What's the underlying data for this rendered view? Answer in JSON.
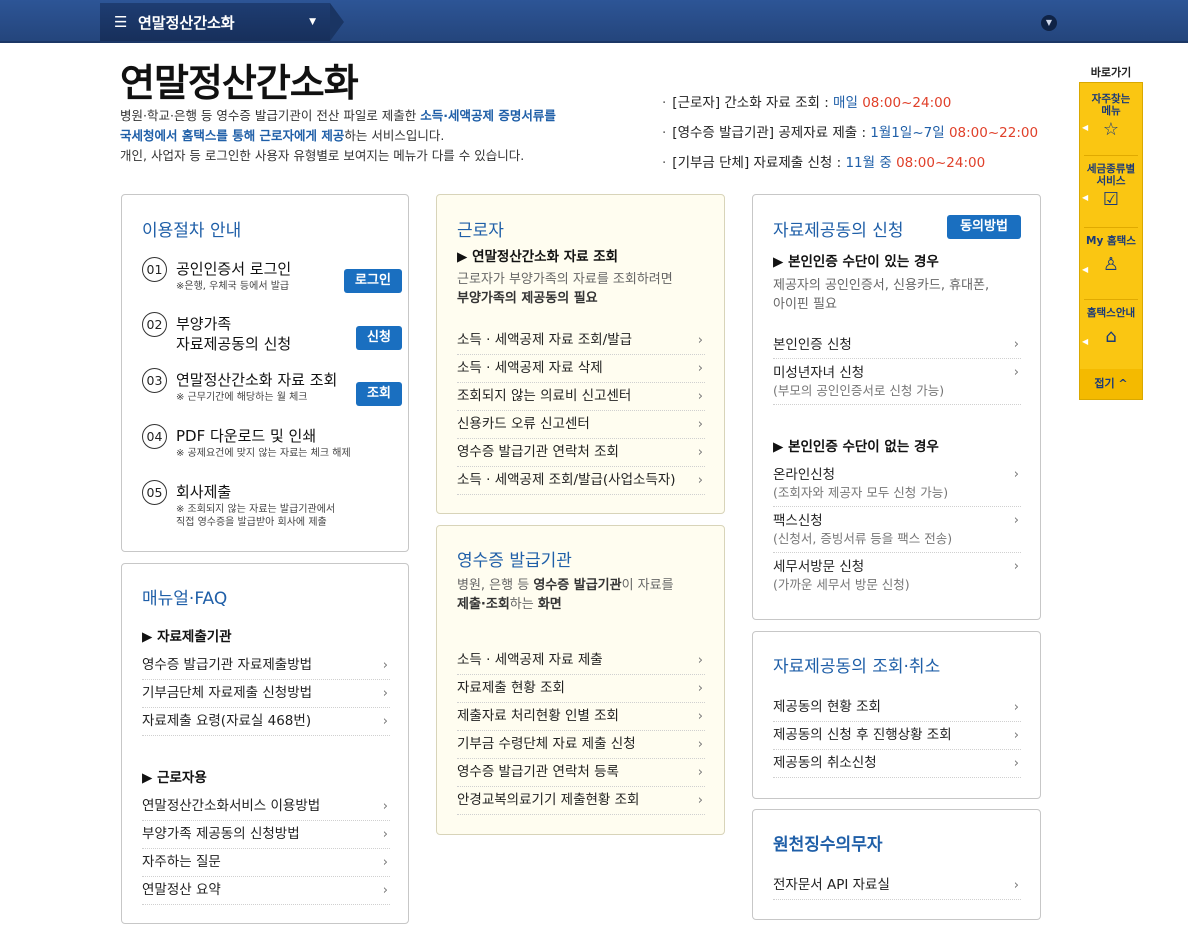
{
  "nav": {
    "title": "연말정산간소화",
    "menu_icon": "hamburger-icon",
    "caret": "▼",
    "expand_icon": "chevron-down-icon"
  },
  "header": {
    "title": "연말정산간소화",
    "intro_1a": "병원·학교·은행 등 영수증 발급기관이 전산 파일로 제출한 ",
    "intro_1b": "소득·세액공제 증명서류를",
    "intro_2a": "국세청에서 홈택스를 통해 근로자에게 제공",
    "intro_2b": "하는 서비스입니다.",
    "intro_3": "개인, 사업자 등 로그인한 사용자 유형별로 보여지는 메뉴가 다를 수 있습니다."
  },
  "schedule": [
    {
      "label": "[근로자] 간소화 자료 조회 : ",
      "period": "매일",
      "time": "08:00~24:00"
    },
    {
      "label": "[영수증 발급기관] 공제자료 제출 : ",
      "period": "1월1일~7일",
      "time": "08:00~22:00"
    },
    {
      "label": "[기부금 단체] 자료제출 신청 : ",
      "period": "11월 중",
      "time": "08:00~24:00"
    }
  ],
  "procedure": {
    "title": "이용절차 안내",
    "steps": [
      {
        "num": "01",
        "label": "공인인증서 로그인",
        "note": "※은행, 우체국 등에서 발급",
        "button": "로그인"
      },
      {
        "num": "02",
        "label": "부양가족",
        "label2": "자료제공동의 신청",
        "button": "신청"
      },
      {
        "num": "03",
        "label": "연말정산간소화 자료 조회",
        "note": "※ 근무기간에 해당하는 월 체크",
        "button": "조회"
      },
      {
        "num": "04",
        "label": "PDF 다운로드 및 인쇄",
        "note": "※ 공제요건에 맞지 않는 자료는 체크 해제"
      },
      {
        "num": "05",
        "label": "회사제출",
        "note": "※ 조회되지 않는 자료는 발급기관에서",
        "note2": "직접 영수증을 발급받아 회사에 제출"
      }
    ]
  },
  "manual": {
    "title": "매뉴얼·FAQ",
    "group1": "▶ 자료제출기관",
    "items1": [
      "영수증 발급기관 자료제출방법",
      "기부금단체 자료제출 신청방법",
      "자료제출 요령(자료실 468번)"
    ],
    "group2": "▶ 근로자용",
    "items2": [
      "연말정산간소화서비스 이용방법",
      "부양가족 제공동의 신청방법",
      "자주하는 질문",
      "연말정산 요약"
    ]
  },
  "worker": {
    "title": "근로자",
    "sub": "▶ 연말정산간소화 자료 조회",
    "desc1": "근로자가 부양가족의 자료를 조회하려면",
    "desc2": "부양가족의 제공동의 필요",
    "items": [
      "소득 · 세액공제 자료 조회/발급",
      "소득 · 세액공제 자료 삭제",
      "조회되지 않는 의료비 신고센터",
      "신용카드 오류 신고센터",
      "영수증 발급기관 연락처 조회",
      "소득 · 세액공제 조회/발급(사업소득자)"
    ]
  },
  "issuer": {
    "title": "영수증 발급기관",
    "desc1a": "병원, 은행 등 ",
    "desc1b": "영수증 발급기관",
    "desc1c": "이 자료를",
    "desc2a": "제출·조회",
    "desc2b": "하는 ",
    "desc2c": "화면",
    "items": [
      "소득 · 세액공제 자료 제출",
      "자료제출 현황 조회",
      "제출자료 처리현황 인별 조회",
      "기부금 수령단체 자료 제출 신청",
      "영수증 발급기관 연락처 등록",
      "안경교복의료기기 제출현황 조회"
    ]
  },
  "consent": {
    "title": "자료제공동의 신청",
    "button": "동의방법",
    "sub1": "▶ 본인인증 수단이 있는 경우",
    "desc1": "제공자의 공인인증서, 신용카드, 휴대폰,",
    "desc2": "아이핀 필요",
    "items1": [
      {
        "label": "본인인증 신청",
        "note": ""
      },
      {
        "label": "미성년자녀 신청",
        "note": "(부모의 공인인증서로 신청 가능)"
      }
    ],
    "sub2": "▶ 본인인증 수단이 없는 경우",
    "items2": [
      {
        "label": "온라인신청",
        "note": "(조회자와 제공자 모두 신청 가능)"
      },
      {
        "label": "팩스신청",
        "note": "(신청서, 증빙서류 등을 팩스 전송)"
      },
      {
        "label": "세무서방문 신청",
        "note": "(가까운 세무서 방문 신청)"
      }
    ]
  },
  "consent_manage": {
    "title": "자료제공동의 조회·취소",
    "items": [
      "제공동의 현황 조회",
      "제공동의 신청 후 진행상황 조회",
      "제공동의 취소신청"
    ]
  },
  "withholding": {
    "title": "원천징수의무자",
    "items": [
      "전자문서 API 자료실"
    ]
  },
  "quick": {
    "title": "바로가기",
    "items": [
      {
        "label1": "자주찾는",
        "label2": "메뉴",
        "icon": "☆"
      },
      {
        "label1": "세금종류별",
        "label2": "서비스",
        "icon": "☑"
      },
      {
        "label1": "My 홈택스",
        "label2": "",
        "icon": "♙"
      },
      {
        "label1": "홈택스안내",
        "label2": "",
        "icon": "⌂"
      }
    ],
    "close": "접기 ^"
  },
  "chevron": "›"
}
